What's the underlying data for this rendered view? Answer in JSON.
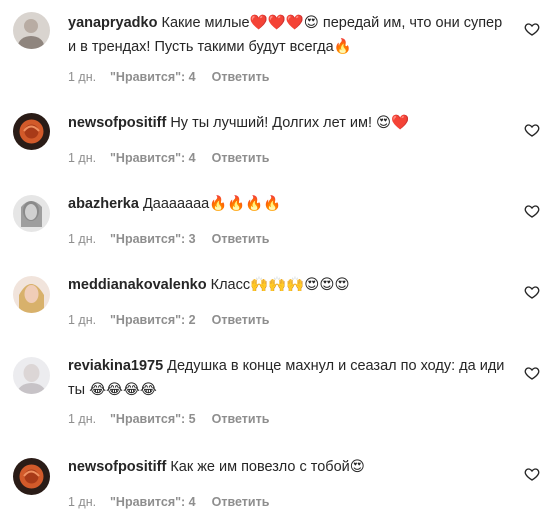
{
  "comments": [
    {
      "username": "yanapryadko",
      "text": "Какие милые❤️❤️❤️😍 передай им, что они супер и в трендах! Пусть такими будут всегда🔥",
      "time": "1 дн.",
      "likes": "\"Нравится\": 4",
      "reply": "Ответить",
      "avatar": "light-photo"
    },
    {
      "username": "newsofpositiff",
      "text": "Ну ты лучший! Долгих лет им! 😍❤️",
      "time": "1 дн.",
      "likes": "\"Нравится\": 4",
      "reply": "Ответить",
      "avatar": "orange-logo"
    },
    {
      "username": "abazherka",
      "text": "Дааааааа🔥🔥🔥🔥",
      "time": "1 дн.",
      "likes": "\"Нравится\": 3",
      "reply": "Ответить",
      "avatar": "bw-photo"
    },
    {
      "username": "meddianakovalenko",
      "text": "Класс🙌🙌🙌😍😍😍",
      "time": "1 дн.",
      "likes": "\"Нравится\": 2",
      "reply": "Ответить",
      "avatar": "blonde-photo"
    },
    {
      "username": "reviakina1975",
      "text": "Дедушка в конце махнул и сеазал по ходу: да иди ты 😂😂😂😂",
      "time": "1 дн.",
      "likes": "\"Нравится\": 5",
      "reply": "Ответить",
      "avatar": "pale-photo"
    },
    {
      "username": "newsofpositiff",
      "text": "Как же им повезло с тобой😍",
      "time": "1 дн.",
      "likes": "\"Нравится\": 4",
      "reply": "Ответить",
      "avatar": "orange-logo"
    }
  ],
  "like_icon": "heart-outline-icon"
}
